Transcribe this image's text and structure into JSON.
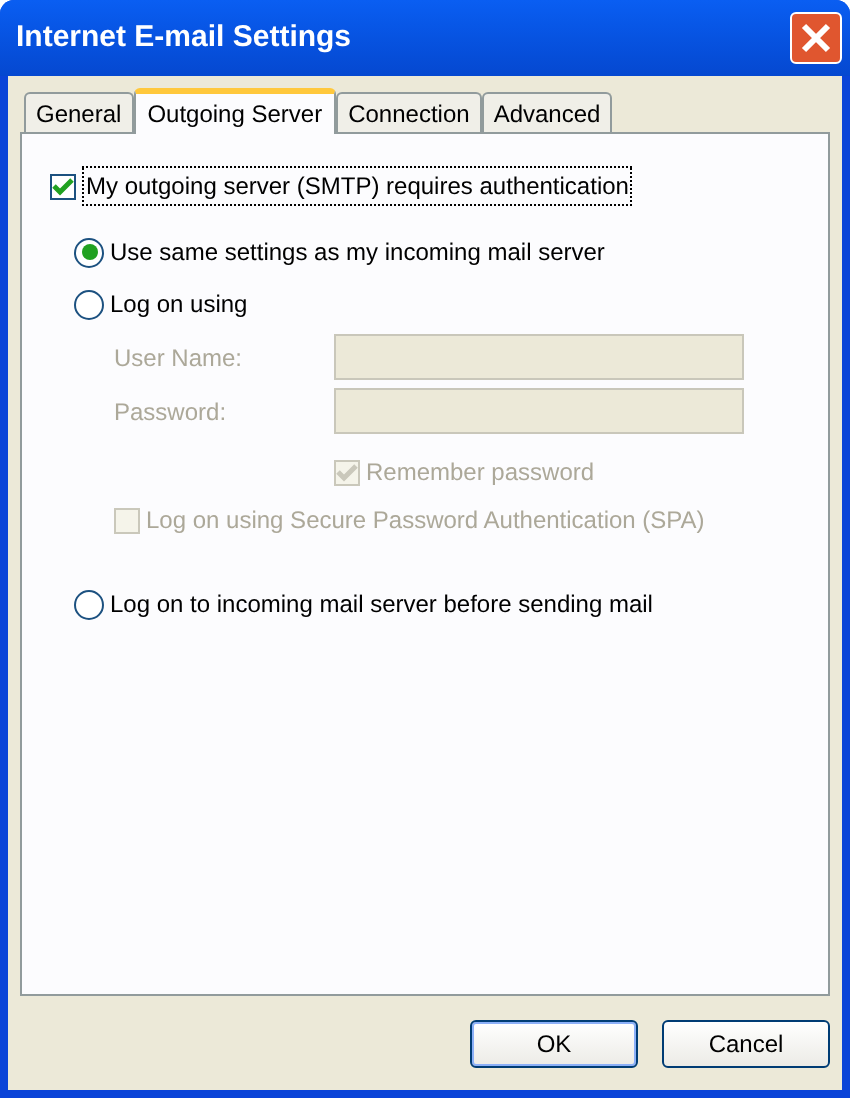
{
  "window": {
    "title": "Internet E-mail Settings"
  },
  "tabs": [
    {
      "label": "General",
      "selected": false
    },
    {
      "label": "Outgoing Server",
      "selected": true
    },
    {
      "label": "Connection",
      "selected": false
    },
    {
      "label": "Advanced",
      "selected": false
    }
  ],
  "authentication": {
    "label": "My outgoing server (SMTP) requires authentication",
    "checked": true
  },
  "logon_options": [
    {
      "label": "Use same settings as my incoming mail server",
      "selected": true
    },
    {
      "label": "Log on using",
      "selected": false
    },
    {
      "label": "Log on to incoming mail server before sending mail",
      "selected": false
    }
  ],
  "fields": [
    {
      "label": "User Name:",
      "disabled": true
    },
    {
      "label": "Password:",
      "disabled": true
    }
  ],
  "remember_password": {
    "label": "Remember password",
    "checked": true,
    "disabled": true
  },
  "spa": {
    "label": "Log on using Secure Password Authentication (SPA)",
    "checked": false,
    "disabled": true
  },
  "buttons": [
    {
      "label": "OK",
      "default": true
    },
    {
      "label": "Cancel",
      "default": false
    }
  ]
}
